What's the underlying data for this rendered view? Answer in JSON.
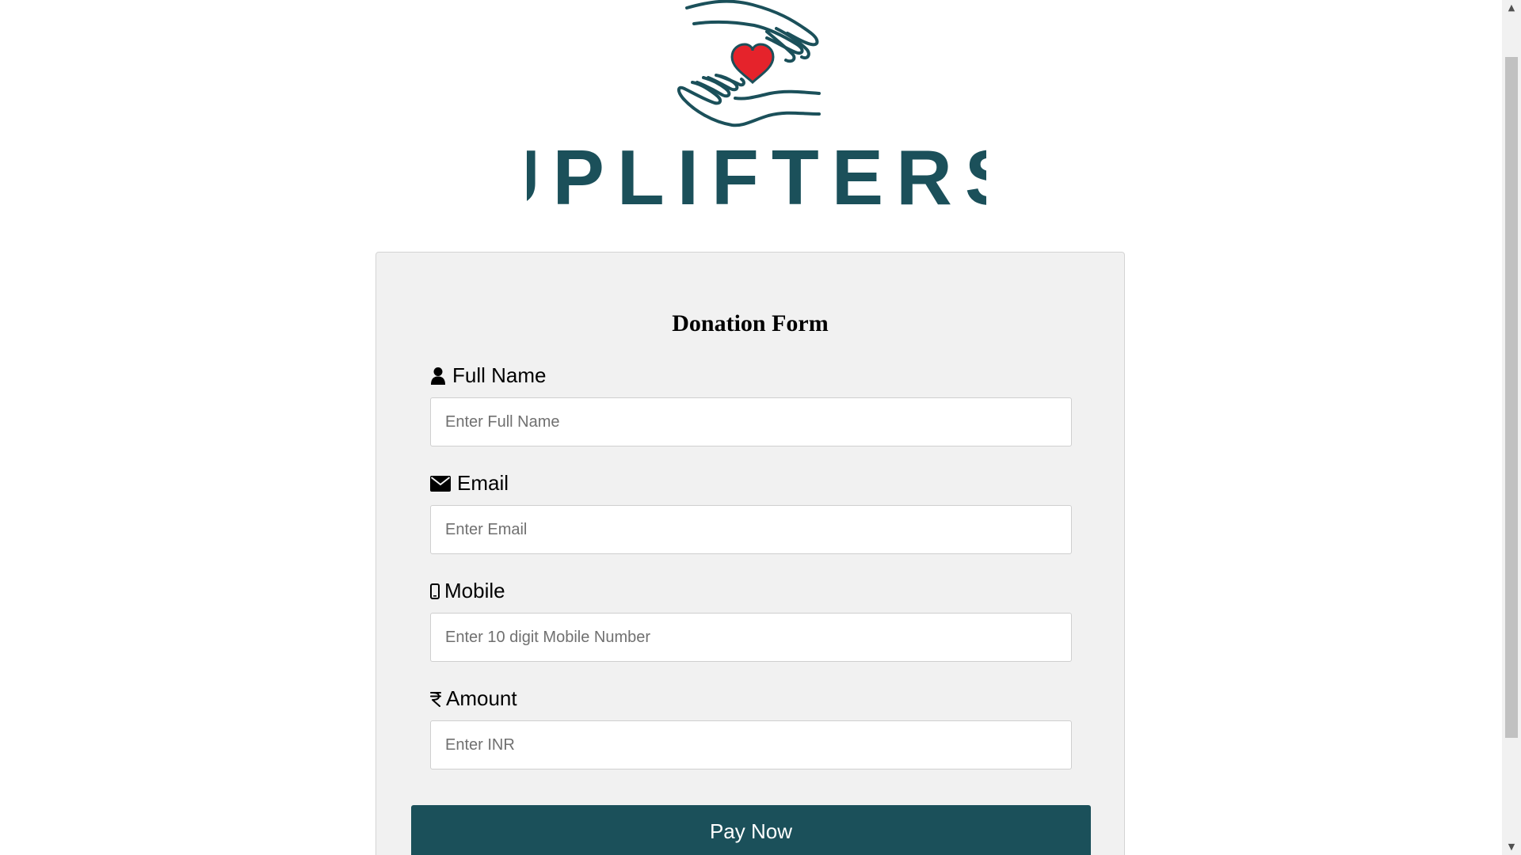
{
  "brand": {
    "name": "UPLIFTERS",
    "logo_icon": "hands-holding-heart-icon",
    "primary_color": "#1b505a",
    "heart_color": "#e5232b"
  },
  "form": {
    "title": "Donation Form",
    "fields": [
      {
        "label": "Full Name",
        "icon": "user-icon",
        "placeholder": "Enter Full Name",
        "value": ""
      },
      {
        "label": "Email",
        "icon": "envelope-icon",
        "placeholder": "Enter Email",
        "value": ""
      },
      {
        "label": "Mobile",
        "icon": "mobile-phone-icon",
        "placeholder": "Enter 10 digit Mobile Number",
        "value": ""
      },
      {
        "label": "Amount",
        "icon": "rupee-icon",
        "placeholder": "Enter INR",
        "value": ""
      }
    ],
    "submit_label": "Pay Now"
  }
}
